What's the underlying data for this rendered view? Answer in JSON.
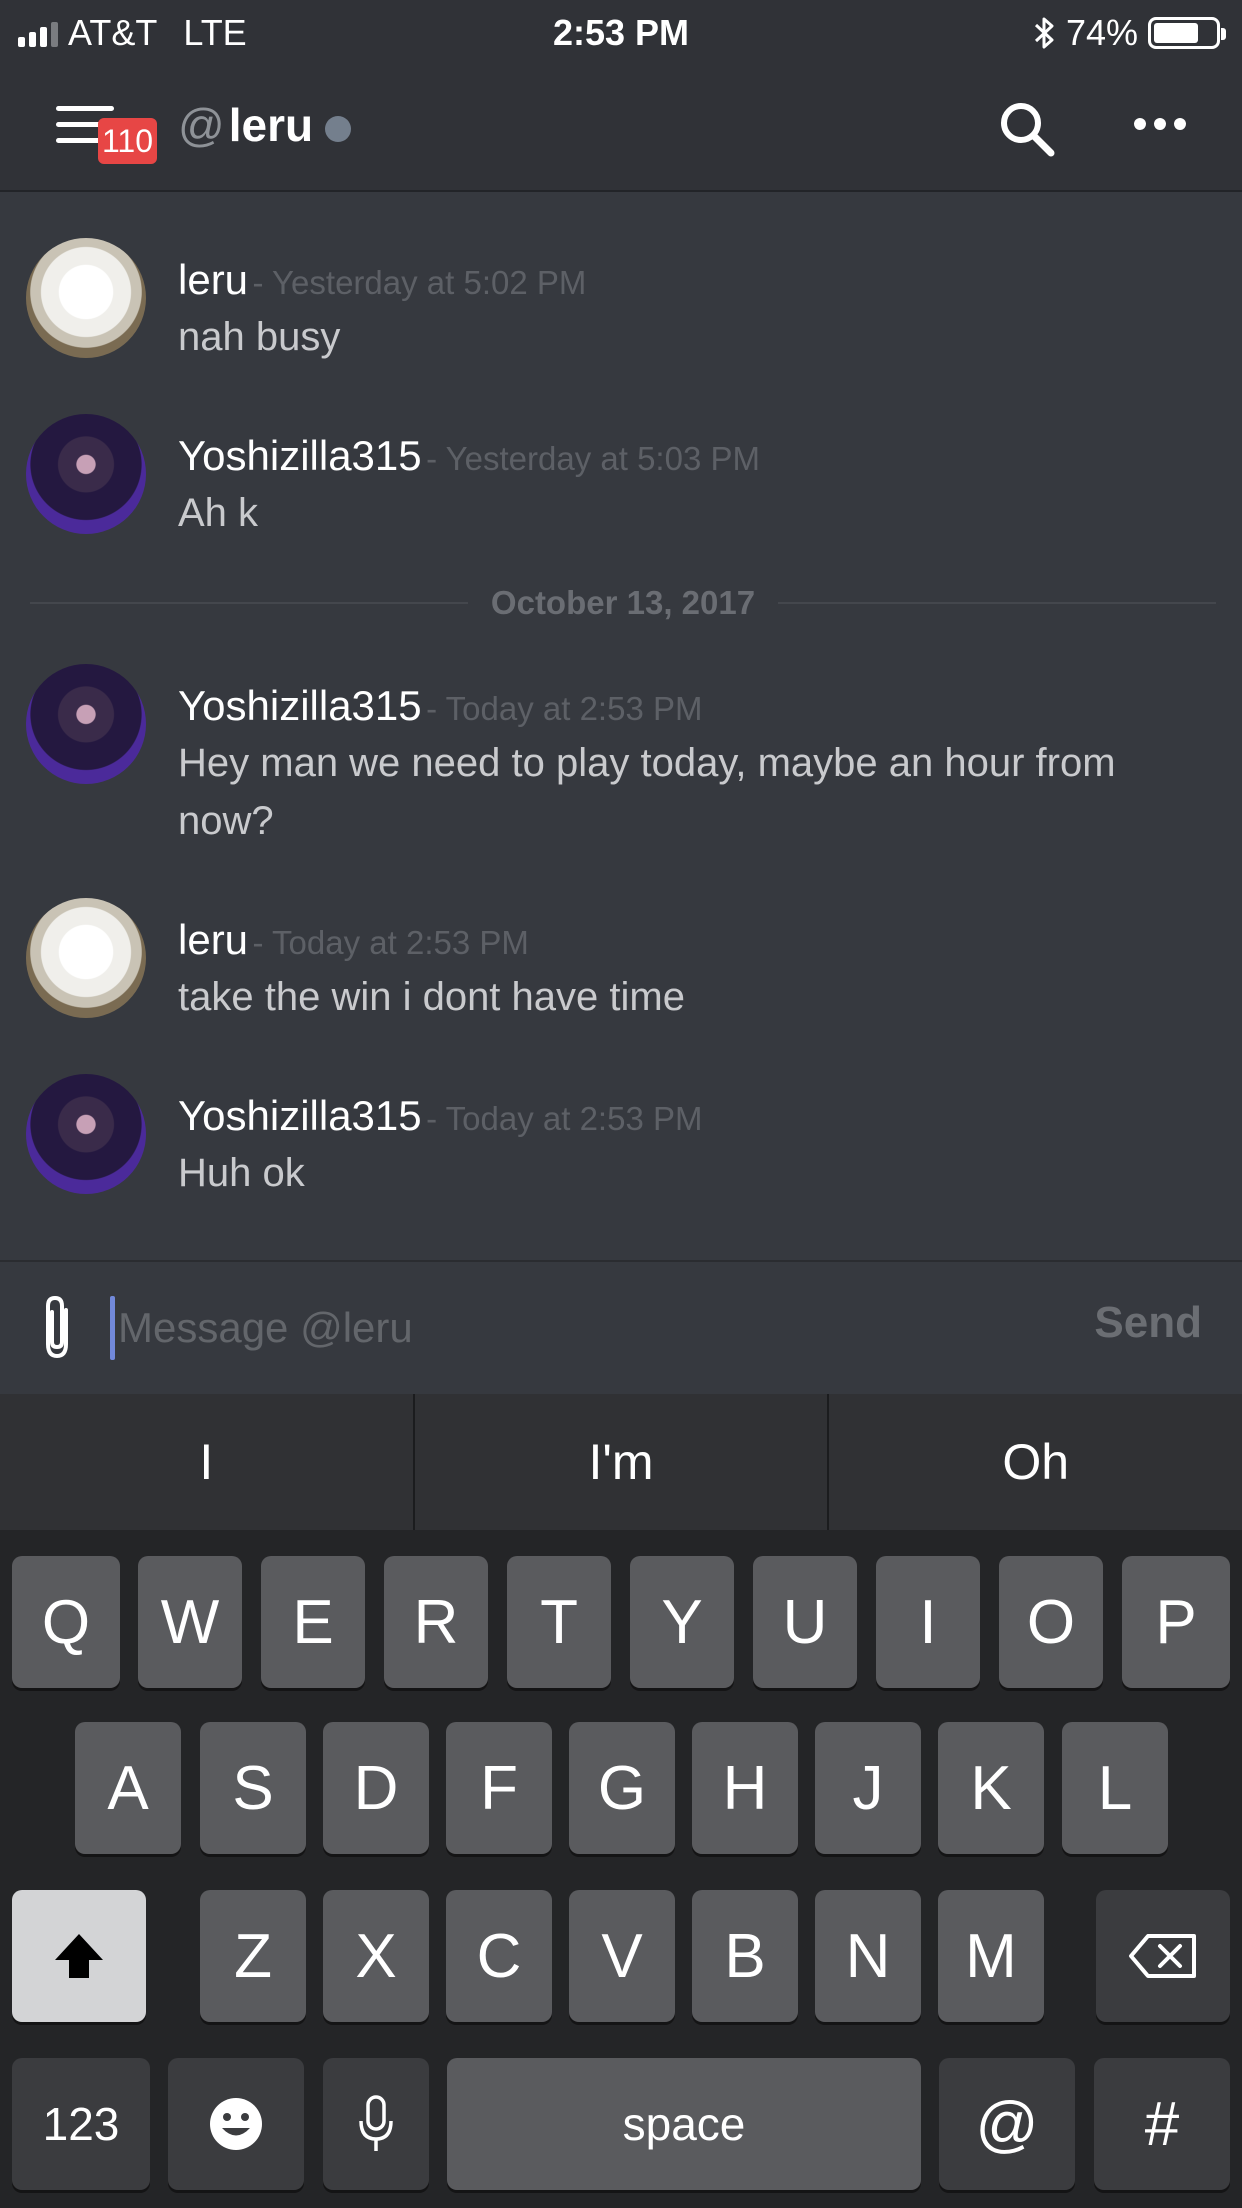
{
  "status_bar": {
    "carrier": "AT&T",
    "network": "LTE",
    "time": "2:53 PM",
    "battery_percent": "74%",
    "battery_level": 0.74,
    "icons": [
      "signal-icon",
      "bluetooth-icon",
      "battery-icon"
    ]
  },
  "header": {
    "unread_badge": "110",
    "at_symbol": "@",
    "channel_name": "leru",
    "presence_color": "#747f8d",
    "icons": [
      "menu-icon",
      "search-icon",
      "more-icon"
    ]
  },
  "messages": [
    {
      "author": "leru",
      "timestamp": "- Yesterday at 5:02 PM",
      "text": "nah busy",
      "avatar": "samoyed"
    },
    {
      "author": "Yoshizilla315",
      "timestamp": "- Yesterday at 5:03 PM",
      "text": "Ah k",
      "avatar": "performer"
    },
    {
      "author": "Yoshizilla315",
      "timestamp": "- Today at 2:53 PM",
      "text": "Hey man we need to play today, maybe an hour from now?",
      "avatar": "performer"
    },
    {
      "author": "leru",
      "timestamp": "- Today at 2:53 PM",
      "text": "take the win i dont have time",
      "avatar": "samoyed"
    },
    {
      "author": "Yoshizilla315",
      "timestamp": "- Today at 2:53 PM",
      "text": "Huh ok",
      "avatar": "performer"
    }
  ],
  "date_divider": "October 13, 2017",
  "composer": {
    "placeholder": "Message @leru",
    "value": "",
    "send_label": "Send",
    "accent_color": "#7289da"
  },
  "keyboard": {
    "suggestions": [
      "I",
      "I'm",
      "Oh"
    ],
    "row1": [
      "Q",
      "W",
      "E",
      "R",
      "T",
      "Y",
      "U",
      "I",
      "O",
      "P"
    ],
    "row2": [
      "A",
      "S",
      "D",
      "F",
      "G",
      "H",
      "J",
      "K",
      "L"
    ],
    "row3": [
      "Z",
      "X",
      "C",
      "V",
      "B",
      "N",
      "M"
    ],
    "numbers_label": "123",
    "space_label": "space",
    "at_label": "@",
    "hash_label": "#"
  }
}
